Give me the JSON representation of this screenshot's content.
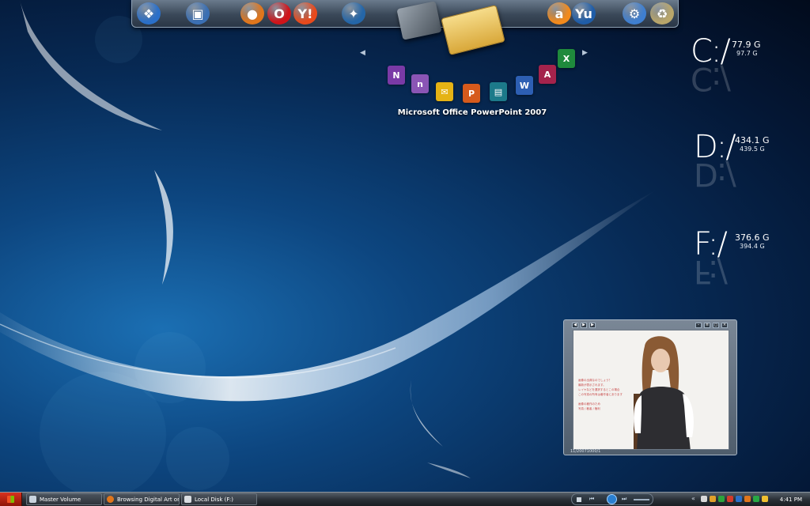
{
  "dock": {
    "icons": [
      {
        "name": "windows-start-orb-icon",
        "glyph": "❖",
        "color": "#2a6fc9"
      },
      {
        "name": "my-computer-icon",
        "glyph": "▣",
        "color": "#3b6fb3"
      },
      {
        "name": "firefox-icon",
        "glyph": "●",
        "color": "#e0761c"
      },
      {
        "name": "opera-icon",
        "glyph": "O",
        "color": "#d0141a"
      },
      {
        "name": "yahoo-messenger-icon",
        "glyph": "Y!",
        "color": "#e84a1c"
      },
      {
        "name": "network-globe-icon",
        "glyph": "✦",
        "color": "#2466a8"
      },
      {
        "name": "avast-antivirus-icon",
        "glyph": "a",
        "color": "#f28a1c"
      },
      {
        "name": "yu-app-icon",
        "glyph": "Yu",
        "color": "#1f5da8"
      },
      {
        "name": "control-panel-icon",
        "glyph": "⚙",
        "color": "#3f7fd0"
      },
      {
        "name": "recycle-bin-icon",
        "glyph": "♻",
        "color": "#b9a66a"
      }
    ]
  },
  "office_fan": {
    "label": "Microsoft Office PowerPoint 2007",
    "icons": [
      {
        "name": "onenote-icon",
        "glyph": "N",
        "color": "#7a3aa6"
      },
      {
        "name": "infopath-icon",
        "glyph": "n",
        "color": "#8a55b5"
      },
      {
        "name": "outlook-icon",
        "glyph": "✉",
        "color": "#e5b315"
      },
      {
        "name": "powerpoint-icon",
        "glyph": "P",
        "color": "#d65a1c"
      },
      {
        "name": "publisher-icon",
        "glyph": "▤",
        "color": "#1c7a8a"
      },
      {
        "name": "word-icon",
        "glyph": "W",
        "color": "#2d5fb3"
      },
      {
        "name": "access-icon",
        "glyph": "A",
        "color": "#a4234c"
      },
      {
        "name": "excel-icon",
        "glyph": "X",
        "color": "#1f8a3c"
      }
    ]
  },
  "drives": [
    {
      "letter": "C:/",
      "used": "77.9 G",
      "total": "97.7 G"
    },
    {
      "letter": "D:/",
      "used": "434.1 G",
      "total": "439.5 G"
    },
    {
      "letter": "F:/",
      "used": "376.6 G",
      "total": "394.4 G"
    }
  ],
  "photo_widget": {
    "caption": "11/20071000/1",
    "text_lines": [
      "画像の出典なのでしょう？",
      "最新が表示されます。",
      "レイヤなどを選択するとこの場合",
      "この写真の所有は著作者にあります"
    ],
    "credit_line": "画像の著作のため",
    "credit_line2": "写真 / 著者 / 権利"
  },
  "taskbar": {
    "tasks": [
      {
        "label": "Master Volume",
        "icon_color": "#c9d3de"
      },
      {
        "label": "Browsing Digital Art on...",
        "icon_color": "#e0761c"
      },
      {
        "label": "Local Disk (F:)",
        "icon_color": "#d9dde2"
      }
    ],
    "clock": "4:41 PM",
    "tray_colors": [
      "#d9d9d9",
      "#e0a02a",
      "#2aa33c",
      "#d43a2a",
      "#2a6fc9",
      "#e0761c",
      "#28a845",
      "#f0c030"
    ]
  }
}
